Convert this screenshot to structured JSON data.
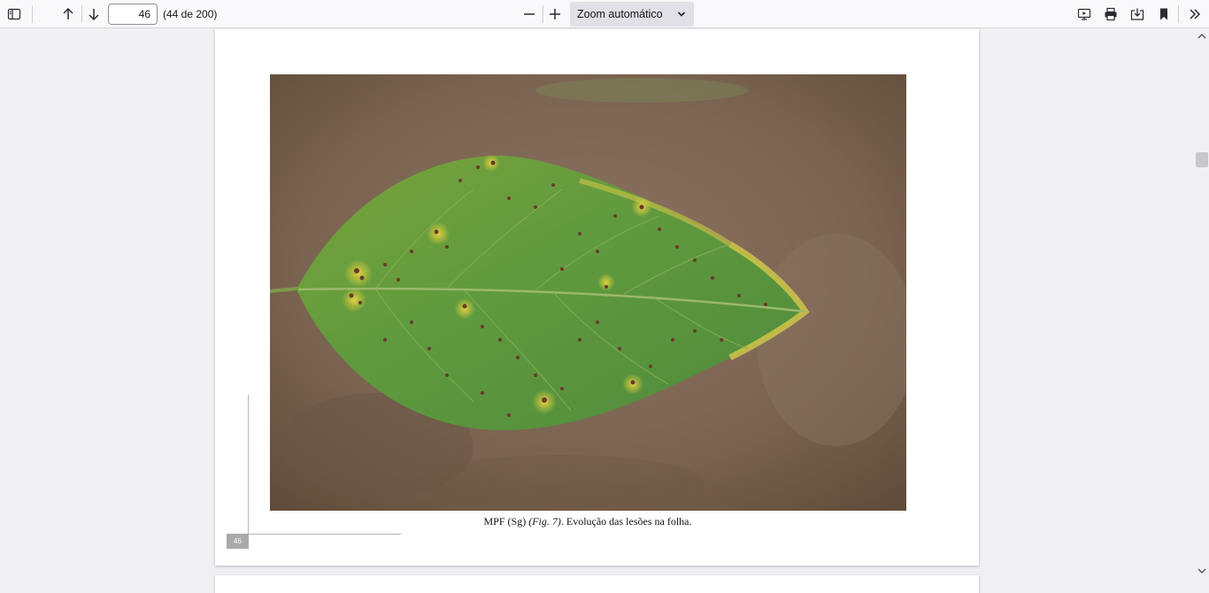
{
  "toolbar": {
    "sidebar_icon": "sidebar-toggle-icon",
    "prev_icon": "arrow-up-icon",
    "next_icon": "arrow-down-icon",
    "page_value": "46",
    "page_count": "(44 de 200)",
    "zoom_out_icon": "minus-icon",
    "zoom_in_icon": "plus-icon",
    "zoom_value": "Zoom automático",
    "presentation_icon": "presentation-icon",
    "print_icon": "print-icon",
    "save_icon": "save-icon",
    "bookmark_icon": "bookmark-icon",
    "tools_icon": "double-chevron-right-icon"
  },
  "document": {
    "caption_prefix": "MPF (Sg) ",
    "caption_fig": "(Fig. 7)",
    "caption_suffix": ". Evolução das lesões na folha.",
    "page_number": "46",
    "image_subject": "soybean-leaf-with-lesions-photo"
  }
}
